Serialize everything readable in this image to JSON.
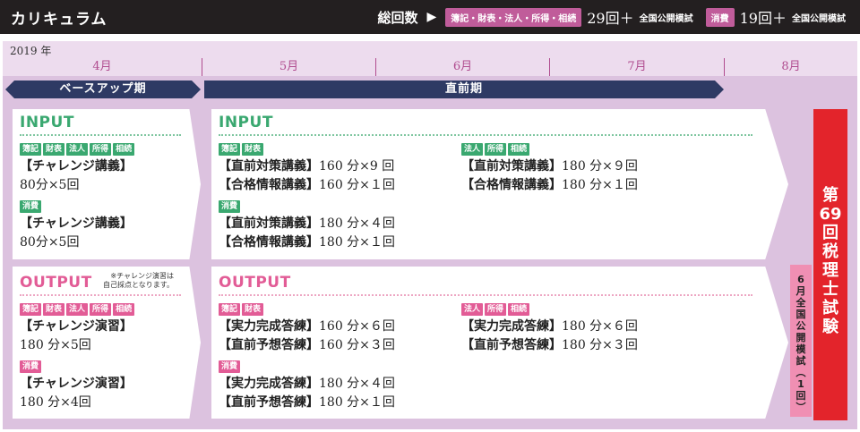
{
  "header": {
    "title": "カリキュラム",
    "total_label": "総回数",
    "arrow": "▶",
    "group1_badge": "簿記・財表・法人・所得・相続",
    "group1_count": "29回＋",
    "group1_mock": "全国公開模試",
    "group2_badge": "消費",
    "group2_count": "19回＋",
    "group2_mock": "全国公開模試"
  },
  "timeline": {
    "year": "2019 年",
    "months": [
      "4月",
      "5月",
      "6月",
      "7月",
      "8月"
    ],
    "phase1": "ベースアップ期",
    "phase2": "直前期"
  },
  "base_input": {
    "heading": "INPUT",
    "tags_a": [
      "簿記",
      "財表",
      "法人",
      "所得",
      "相続"
    ],
    "a_title": "【チャレンジ講義】",
    "a_detail": "80分×5回",
    "tags_b": [
      "消費"
    ],
    "b_title": "【チャレンジ講義】",
    "b_detail": "80分×5回"
  },
  "base_output": {
    "heading": "OUTPUT",
    "note1": "※チャレンジ演習は",
    "note2": "自己採点となります。",
    "tags_a": [
      "簿記",
      "財表",
      "法人",
      "所得",
      "相続"
    ],
    "a_title": "【チャレンジ演習】",
    "a_detail": "180 分×5回",
    "tags_b": [
      "消費"
    ],
    "b_title": "【チャレンジ演習】",
    "b_detail": "180 分×4回"
  },
  "pre_input": {
    "heading": "INPUT",
    "left_tags": [
      "簿記",
      "財表"
    ],
    "left": [
      {
        "title": "【直前対策講義】",
        "detail": "160 分×9 回"
      },
      {
        "title": "【合格情報講義】",
        "detail": "160 分×１回"
      }
    ],
    "left2_tags": [
      "消費"
    ],
    "left2": [
      {
        "title": "【直前対策講義】",
        "detail": "180 分×４回"
      },
      {
        "title": "【合格情報講義】",
        "detail": "180 分×１回"
      }
    ],
    "right_tags": [
      "法人",
      "所得",
      "相続"
    ],
    "right": [
      {
        "title": "【直前対策講義】",
        "detail": "180 分×９回"
      },
      {
        "title": "【合格情報講義】",
        "detail": "180 分×１回"
      }
    ]
  },
  "pre_output": {
    "heading": "OUTPUT",
    "left_tags": [
      "簿記",
      "財表"
    ],
    "left": [
      {
        "title": "【実力完成答練】",
        "detail": "160 分×６回"
      },
      {
        "title": "【直前予想答練】",
        "detail": "160 分×３回"
      }
    ],
    "left2_tags": [
      "消費"
    ],
    "left2": [
      {
        "title": "【実力完成答練】",
        "detail": "180 分×４回"
      },
      {
        "title": "【直前予想答練】",
        "detail": "180 分×１回"
      }
    ],
    "right_tags": [
      "法人",
      "所得",
      "相続"
    ],
    "right": [
      {
        "title": "【実力完成答練】",
        "detail": "180 分×６回"
      },
      {
        "title": "【直前予想答練】",
        "detail": "180 分×３回"
      }
    ]
  },
  "exam": {
    "chars": [
      "第",
      "69",
      "回",
      "税",
      "理",
      "士",
      "試",
      "験"
    ]
  },
  "mock_exam": {
    "chars": [
      "6",
      "月",
      "全",
      "国",
      "公",
      "開",
      "模",
      "試",
      "︵",
      "1",
      "回",
      "︶"
    ]
  },
  "colors": {
    "input_green": "#3aa870",
    "output_pink": "#e25c96",
    "banner_navy": "#2e3a64",
    "exam_red": "#e3242b",
    "lavender": "#dcc2df"
  }
}
